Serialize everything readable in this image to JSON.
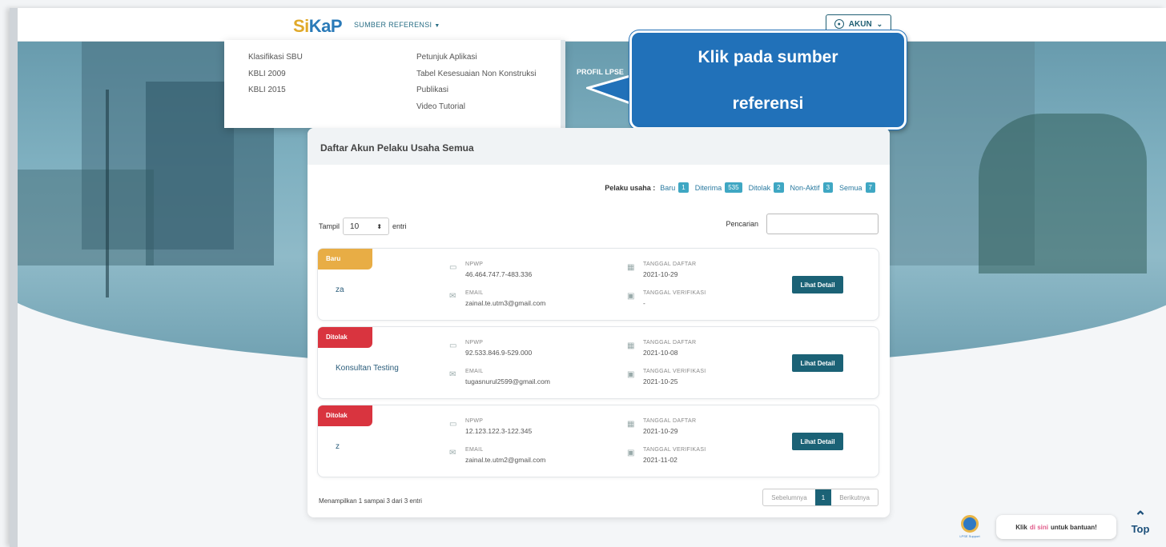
{
  "nav": {
    "logo_s": "Si",
    "logo_k": "KaP",
    "sumber_referensi": "SUMBER REFERENSI",
    "akun": "AKUN",
    "profil": "PROFIL LPSE"
  },
  "dropdown": {
    "col1": [
      "Klasifikasi SBU",
      "KBLI 2009",
      "KBLI 2015"
    ],
    "col2": [
      "Petunjuk Aplikasi",
      "Tabel Kesesuaian Non Konstruksi",
      "Publikasi",
      "Video Tutorial"
    ]
  },
  "callout": {
    "line1": "Klik pada sumber",
    "line2": "referensi"
  },
  "card": {
    "title": "Daftar Akun Pelaku Usaha Semua",
    "status_label": "Pelaku usaha :",
    "statuses": [
      {
        "label": "Baru",
        "count": "1"
      },
      {
        "label": "Diterima",
        "count": "535"
      },
      {
        "label": "Ditolak",
        "count": "2"
      },
      {
        "label": "Non-Aktif",
        "count": "3"
      },
      {
        "label": "Semua",
        "count": "7"
      }
    ],
    "tampil": "Tampil",
    "page_size": "10",
    "entri": "entri",
    "pencarian": "Pencarian",
    "search_value": ""
  },
  "entries": [
    {
      "status": "Baru",
      "name": "za",
      "npwp_label": "NPWP",
      "npwp": "46.464.747.7-483.336",
      "email_label": "EMAIL",
      "email": "zainal.te.utm3@gmail.com",
      "tgl_daftar_label": "TANGGAL DAFTAR",
      "tgl_daftar": "2021-10-29",
      "tgl_verif_label": "TANGGAL VERIFIKASI",
      "tgl_verif": "-",
      "button": "Lihat Detail"
    },
    {
      "status": "Ditolak",
      "name": "Konsultan Testing",
      "npwp_label": "NPWP",
      "npwp": "92.533.846.9-529.000",
      "email_label": "EMAIL",
      "email": "tugasnurul2599@gmail.com",
      "tgl_daftar_label": "TANGGAL DAFTAR",
      "tgl_daftar": "2021-10-08",
      "tgl_verif_label": "TANGGAL VERIFIKASI",
      "tgl_verif": "2021-10-25",
      "button": "Lihat Detail"
    },
    {
      "status": "Ditolak",
      "name": "z",
      "npwp_label": "NPWP",
      "npwp": "12.123.122.3-122.345",
      "email_label": "EMAIL",
      "email": "zainal.te.utm2@gmail.com",
      "tgl_daftar_label": "TANGGAL DAFTAR",
      "tgl_daftar": "2021-10-29",
      "tgl_verif_label": "TANGGAL VERIFIKASI",
      "tgl_verif": "2021-11-02",
      "button": "Lihat Detail"
    }
  ],
  "footer": {
    "info": "Menampilkan 1 sampai 3 dari 3 entri",
    "prev": "Sebelumnya",
    "page": "1",
    "next": "Berikutnya"
  },
  "support": {
    "label": "LPSE Support",
    "help_pre": "Klik",
    "help_hl": "di sini",
    "help_post": "untuk bantuan!",
    "top": "Top"
  },
  "colors": {
    "primary": "#1b6276",
    "callout": "#2171b9",
    "baru": "#e8ad45",
    "ditolak": "#d9343f",
    "badge": "#3fa7c3"
  }
}
